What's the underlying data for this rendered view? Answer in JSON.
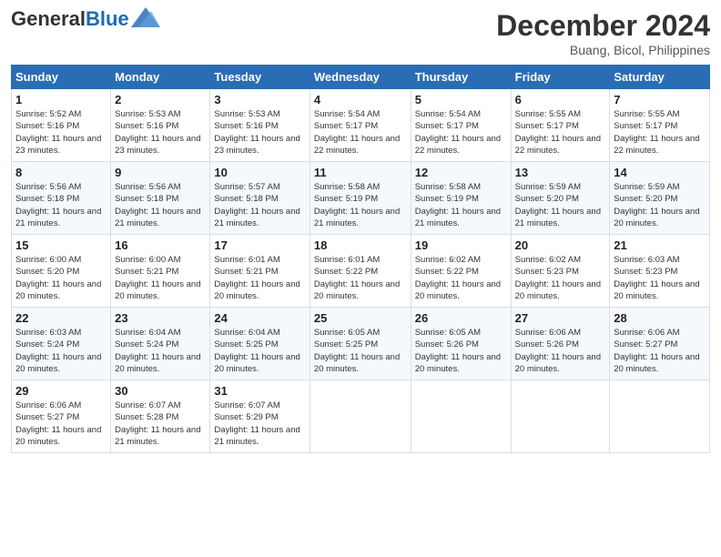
{
  "header": {
    "logo_general": "General",
    "logo_blue": "Blue",
    "month_title": "December 2024",
    "location": "Buang, Bicol, Philippines"
  },
  "weekdays": [
    "Sunday",
    "Monday",
    "Tuesday",
    "Wednesday",
    "Thursday",
    "Friday",
    "Saturday"
  ],
  "weeks": [
    [
      {
        "day": "1",
        "sunrise": "Sunrise: 5:52 AM",
        "sunset": "Sunset: 5:16 PM",
        "daylight": "Daylight: 11 hours and 23 minutes."
      },
      {
        "day": "2",
        "sunrise": "Sunrise: 5:53 AM",
        "sunset": "Sunset: 5:16 PM",
        "daylight": "Daylight: 11 hours and 23 minutes."
      },
      {
        "day": "3",
        "sunrise": "Sunrise: 5:53 AM",
        "sunset": "Sunset: 5:16 PM",
        "daylight": "Daylight: 11 hours and 23 minutes."
      },
      {
        "day": "4",
        "sunrise": "Sunrise: 5:54 AM",
        "sunset": "Sunset: 5:17 PM",
        "daylight": "Daylight: 11 hours and 22 minutes."
      },
      {
        "day": "5",
        "sunrise": "Sunrise: 5:54 AM",
        "sunset": "Sunset: 5:17 PM",
        "daylight": "Daylight: 11 hours and 22 minutes."
      },
      {
        "day": "6",
        "sunrise": "Sunrise: 5:55 AM",
        "sunset": "Sunset: 5:17 PM",
        "daylight": "Daylight: 11 hours and 22 minutes."
      },
      {
        "day": "7",
        "sunrise": "Sunrise: 5:55 AM",
        "sunset": "Sunset: 5:17 PM",
        "daylight": "Daylight: 11 hours and 22 minutes."
      }
    ],
    [
      {
        "day": "8",
        "sunrise": "Sunrise: 5:56 AM",
        "sunset": "Sunset: 5:18 PM",
        "daylight": "Daylight: 11 hours and 21 minutes."
      },
      {
        "day": "9",
        "sunrise": "Sunrise: 5:56 AM",
        "sunset": "Sunset: 5:18 PM",
        "daylight": "Daylight: 11 hours and 21 minutes."
      },
      {
        "day": "10",
        "sunrise": "Sunrise: 5:57 AM",
        "sunset": "Sunset: 5:18 PM",
        "daylight": "Daylight: 11 hours and 21 minutes."
      },
      {
        "day": "11",
        "sunrise": "Sunrise: 5:58 AM",
        "sunset": "Sunset: 5:19 PM",
        "daylight": "Daylight: 11 hours and 21 minutes."
      },
      {
        "day": "12",
        "sunrise": "Sunrise: 5:58 AM",
        "sunset": "Sunset: 5:19 PM",
        "daylight": "Daylight: 11 hours and 21 minutes."
      },
      {
        "day": "13",
        "sunrise": "Sunrise: 5:59 AM",
        "sunset": "Sunset: 5:20 PM",
        "daylight": "Daylight: 11 hours and 21 minutes."
      },
      {
        "day": "14",
        "sunrise": "Sunrise: 5:59 AM",
        "sunset": "Sunset: 5:20 PM",
        "daylight": "Daylight: 11 hours and 20 minutes."
      }
    ],
    [
      {
        "day": "15",
        "sunrise": "Sunrise: 6:00 AM",
        "sunset": "Sunset: 5:20 PM",
        "daylight": "Daylight: 11 hours and 20 minutes."
      },
      {
        "day": "16",
        "sunrise": "Sunrise: 6:00 AM",
        "sunset": "Sunset: 5:21 PM",
        "daylight": "Daylight: 11 hours and 20 minutes."
      },
      {
        "day": "17",
        "sunrise": "Sunrise: 6:01 AM",
        "sunset": "Sunset: 5:21 PM",
        "daylight": "Daylight: 11 hours and 20 minutes."
      },
      {
        "day": "18",
        "sunrise": "Sunrise: 6:01 AM",
        "sunset": "Sunset: 5:22 PM",
        "daylight": "Daylight: 11 hours and 20 minutes."
      },
      {
        "day": "19",
        "sunrise": "Sunrise: 6:02 AM",
        "sunset": "Sunset: 5:22 PM",
        "daylight": "Daylight: 11 hours and 20 minutes."
      },
      {
        "day": "20",
        "sunrise": "Sunrise: 6:02 AM",
        "sunset": "Sunset: 5:23 PM",
        "daylight": "Daylight: 11 hours and 20 minutes."
      },
      {
        "day": "21",
        "sunrise": "Sunrise: 6:03 AM",
        "sunset": "Sunset: 5:23 PM",
        "daylight": "Daylight: 11 hours and 20 minutes."
      }
    ],
    [
      {
        "day": "22",
        "sunrise": "Sunrise: 6:03 AM",
        "sunset": "Sunset: 5:24 PM",
        "daylight": "Daylight: 11 hours and 20 minutes."
      },
      {
        "day": "23",
        "sunrise": "Sunrise: 6:04 AM",
        "sunset": "Sunset: 5:24 PM",
        "daylight": "Daylight: 11 hours and 20 minutes."
      },
      {
        "day": "24",
        "sunrise": "Sunrise: 6:04 AM",
        "sunset": "Sunset: 5:25 PM",
        "daylight": "Daylight: 11 hours and 20 minutes."
      },
      {
        "day": "25",
        "sunrise": "Sunrise: 6:05 AM",
        "sunset": "Sunset: 5:25 PM",
        "daylight": "Daylight: 11 hours and 20 minutes."
      },
      {
        "day": "26",
        "sunrise": "Sunrise: 6:05 AM",
        "sunset": "Sunset: 5:26 PM",
        "daylight": "Daylight: 11 hours and 20 minutes."
      },
      {
        "day": "27",
        "sunrise": "Sunrise: 6:06 AM",
        "sunset": "Sunset: 5:26 PM",
        "daylight": "Daylight: 11 hours and 20 minutes."
      },
      {
        "day": "28",
        "sunrise": "Sunrise: 6:06 AM",
        "sunset": "Sunset: 5:27 PM",
        "daylight": "Daylight: 11 hours and 20 minutes."
      }
    ],
    [
      {
        "day": "29",
        "sunrise": "Sunrise: 6:06 AM",
        "sunset": "Sunset: 5:27 PM",
        "daylight": "Daylight: 11 hours and 20 minutes."
      },
      {
        "day": "30",
        "sunrise": "Sunrise: 6:07 AM",
        "sunset": "Sunset: 5:28 PM",
        "daylight": "Daylight: 11 hours and 21 minutes."
      },
      {
        "day": "31",
        "sunrise": "Sunrise: 6:07 AM",
        "sunset": "Sunset: 5:29 PM",
        "daylight": "Daylight: 11 hours and 21 minutes."
      },
      null,
      null,
      null,
      null
    ]
  ]
}
